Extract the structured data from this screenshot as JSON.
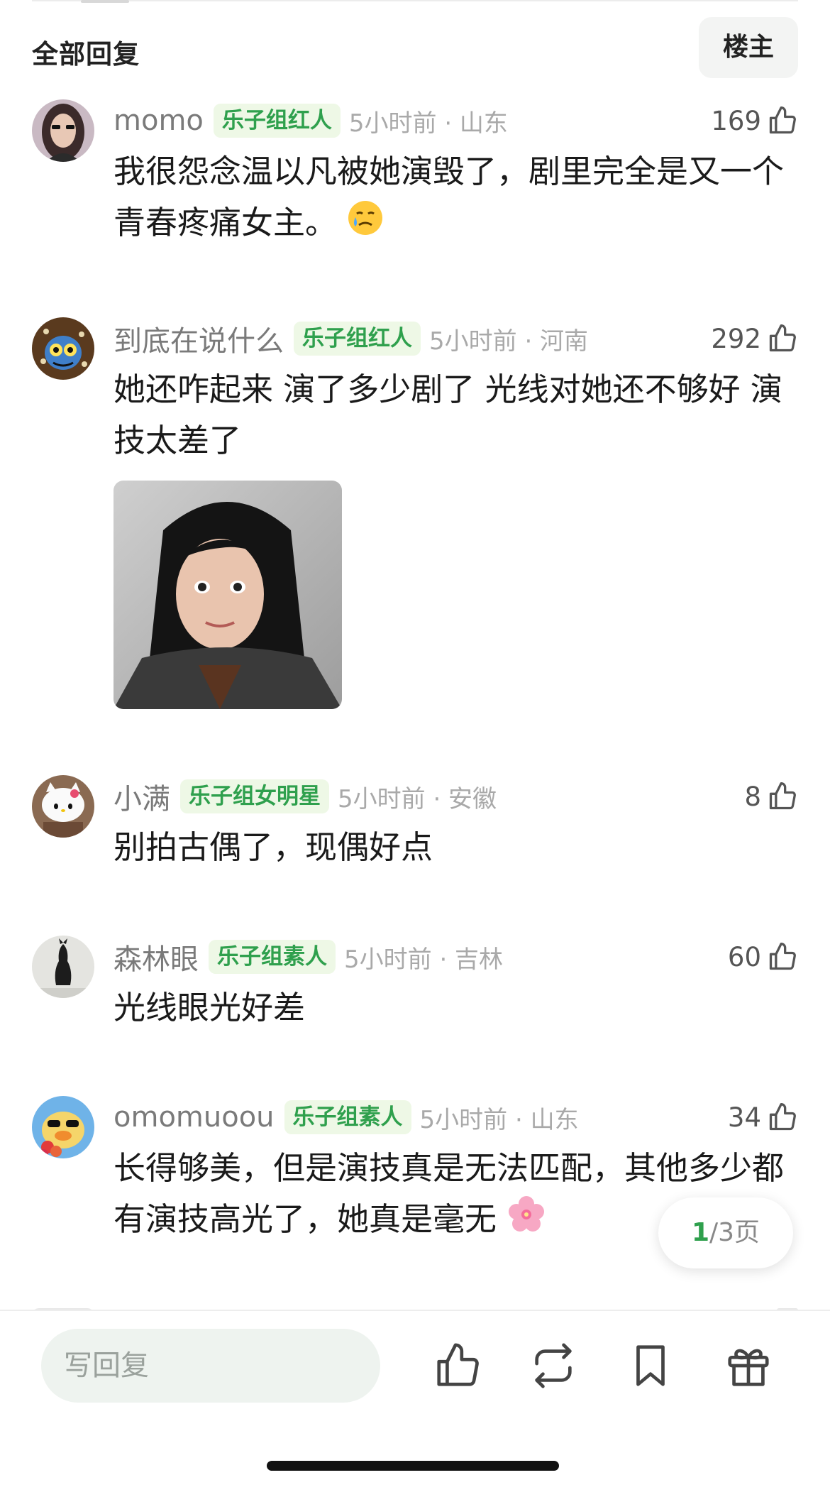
{
  "header": {
    "title": "全部回复",
    "op_filter_label": "楼主"
  },
  "comments": [
    {
      "username": "momo",
      "badge": "乐子组红人",
      "time_location": "5小时前 · 山东",
      "likes": "169",
      "text": "我很怨念温以凡被她演毁了，剧里完全是又一个青春疼痛女主。",
      "emoji": "crying-smile-emoji"
    },
    {
      "username": "到底在说什么",
      "badge": "乐子组红人",
      "time_location": "5小时前 · 河南",
      "likes": "292",
      "text": "她还咋起来 演了多少剧了 光线对她还不够好 演技太差了",
      "image": "woman-photo"
    },
    {
      "username": "小满",
      "badge": "乐子组女明星",
      "time_location": "5小时前 · 安徽",
      "likes": "8",
      "text": "别拍古偶了，现偶好点"
    },
    {
      "username": "森林眼",
      "badge": "乐子组素人",
      "time_location": "5小时前 · 吉林",
      "likes": "60",
      "text": "光线眼光好差"
    },
    {
      "username": "omomuoou",
      "badge": "乐子组素人",
      "time_location": "5小时前 · 山东",
      "likes": "34",
      "text": "长得够美，但是演技真是无法匹配，其他多少都有演技高光了，她真是毫无",
      "emoji": "cherry-blossom-emoji"
    }
  ],
  "pagination": {
    "current": "1",
    "rest": "/3页"
  },
  "bottom_bar": {
    "reply_placeholder": "写回复",
    "icons": [
      "thumbs-up-icon",
      "repost-icon",
      "bookmark-icon",
      "gift-icon"
    ]
  },
  "colors": {
    "accent_green": "#2fa04d",
    "badge_bg": "#eef8e6",
    "meta_gray": "#a9a9a9"
  }
}
